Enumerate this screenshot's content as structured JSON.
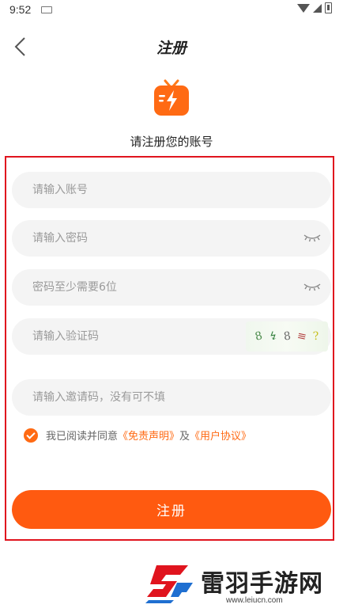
{
  "status_bar": {
    "time": "9:52",
    "icons": [
      "keyboard-icon",
      "wifi-icon",
      "signal-icon",
      "battery-icon"
    ]
  },
  "header": {
    "title": "注册",
    "back_icon": "back-arrow-icon"
  },
  "logo_icon": "tv-lightning-icon",
  "subtitle": "请注册您的账号",
  "form": {
    "account": {
      "placeholder": "请输入账号",
      "value": ""
    },
    "password": {
      "placeholder": "请输入密码",
      "value": ""
    },
    "confirm_password": {
      "placeholder": "密码至少需要6位",
      "value": ""
    },
    "captcha": {
      "placeholder": "请输入验证码",
      "value": "",
      "image_chars": [
        "8",
        "↯",
        "8",
        "≡",
        "?"
      ]
    },
    "invite": {
      "placeholder": "请输入邀请码，没有可不填",
      "value": ""
    }
  },
  "agreement": {
    "checked": true,
    "prefix": "我已阅读并同意",
    "disclaimer": "《免责声明》",
    "joiner": "及",
    "user_agreement": "《用户协议》"
  },
  "submit_label": "注册",
  "watermark": {
    "text": "雷羽手游网",
    "url": "www.leiucn.com"
  },
  "colors": {
    "accent": "#ff5a10",
    "frame": "#e0141e",
    "field_bg": "#f4f4f4"
  }
}
